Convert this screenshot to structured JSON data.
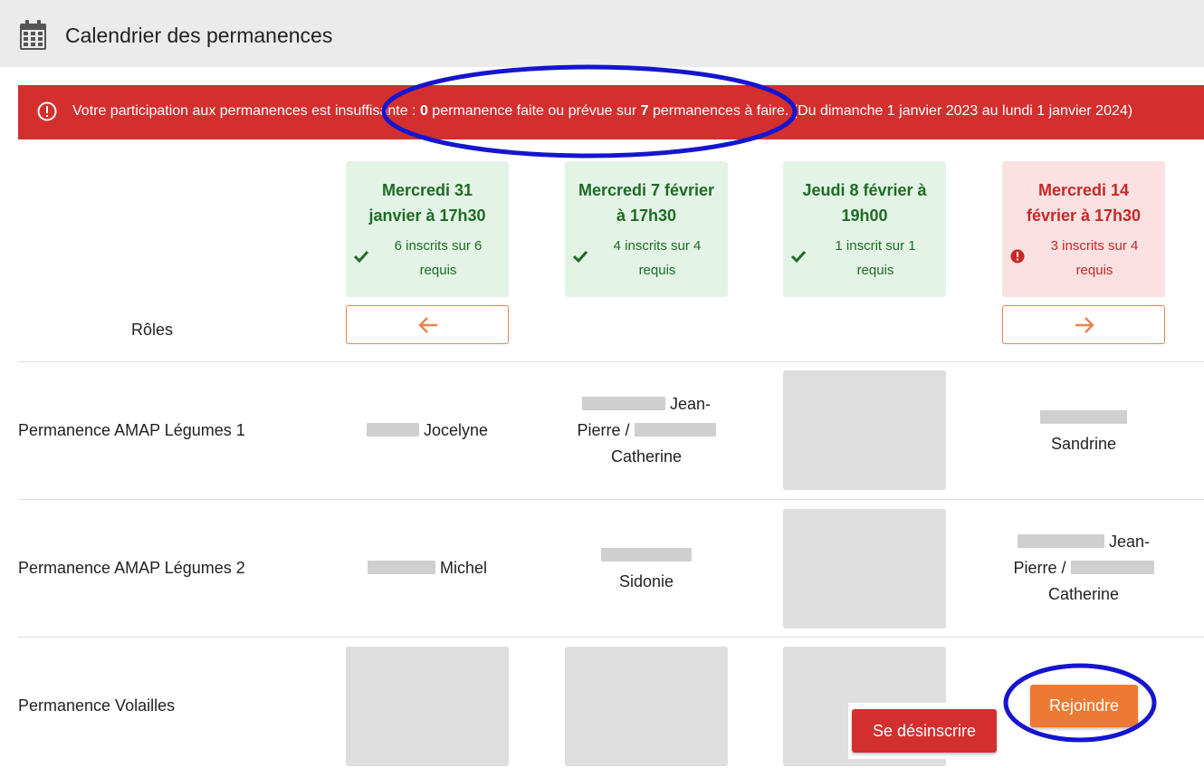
{
  "header": {
    "title": "Calendrier des permanences",
    "icon": "calendar-icon",
    "background": "#ebebeb"
  },
  "alert": {
    "icon": "exclamation-circle-icon",
    "color": "#d32f2f",
    "text_before": "Votre participation aux permanences est insuffisante : ",
    "done_count": "0",
    "text_middle": " permanence faite ou prévue sur ",
    "required_count": "7",
    "text_after": " permanences à faire. (Du dimanche 1 janvier 2023 au lundi 1 janvier 2024)"
  },
  "table": {
    "roles_header": "Rôles",
    "dates": [
      {
        "title": "Mercredi 31 janvier à 17h30",
        "count": "6 inscrits sur 6 requis",
        "status": "complete",
        "icon": "check-icon"
      },
      {
        "title": "Mercredi 7 février à 17h30",
        "count": "4 inscrits sur 4 requis",
        "status": "complete",
        "icon": "check-icon"
      },
      {
        "title": "Jeudi 8 février à 19h00",
        "count": "1 inscrit sur 1 requis",
        "status": "complete",
        "icon": "check-icon"
      },
      {
        "title": "Mercredi 14 février à 17h30",
        "count": "3 inscrits sur 4 requis",
        "status": "incomplete",
        "icon": "exclamation-circle-icon"
      }
    ],
    "prev_icon": "arrow-left-icon",
    "next_icon": "arrow-right-icon",
    "roles": [
      {
        "name": "Permanence AMAP Légumes 1",
        "cells": [
          "Jocelyne",
          "Jean-Pierre / Catherine",
          "",
          "Sandrine"
        ]
      },
      {
        "name": "Permanence AMAP Légumes 2",
        "cells": [
          "Michel",
          "Sidonie",
          "",
          "Jean-Pierre / Catherine"
        ]
      },
      {
        "name": "Permanence Volailles",
        "cells": [
          "",
          "",
          "",
          ""
        ]
      }
    ]
  },
  "actions": {
    "join_label": "Rejoindre",
    "unsubscribe_label": "Se désinscrire",
    "join_color": "#ec7a33",
    "unsubscribe_color": "#d32f2f"
  },
  "colors": {
    "ok_bg": "#e3f3e6",
    "ok_text": "#1e6b23",
    "ko_bg": "#fbe1e1",
    "ko_text": "#c62828",
    "accent": "#e8834d",
    "annotation": "#1515d0"
  }
}
